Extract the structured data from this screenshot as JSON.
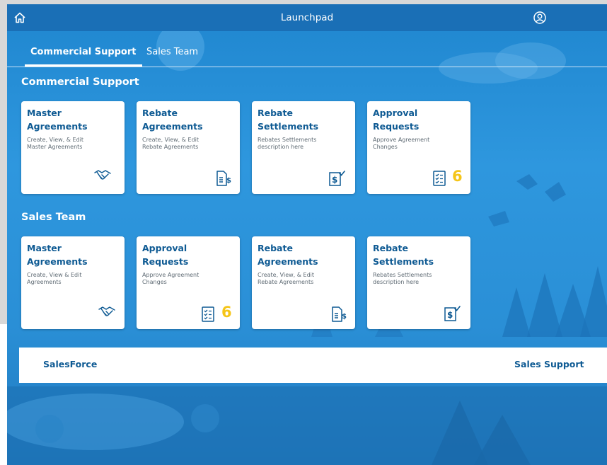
{
  "header": {
    "title": "Launchpad",
    "home_icon": "home-icon",
    "user_icon": "user-account-icon"
  },
  "tabs": [
    {
      "label": "Commercial Support",
      "active": true
    },
    {
      "label": "Sales Team",
      "active": false
    }
  ],
  "sections": [
    {
      "title": "Commercial Support",
      "tiles": [
        {
          "title_line1": "Master",
          "title_line2": "Agreements",
          "desc_line1": "Create, View, & Edit",
          "desc_line2": "Master Agreements",
          "icon": "handshake-icon",
          "badge": ""
        },
        {
          "title_line1": "Rebate",
          "title_line2": "Agreements",
          "desc_line1": "Create, View, & Edit",
          "desc_line2": "Rebate Agreements",
          "icon": "document-dollar-icon",
          "badge": ""
        },
        {
          "title_line1": "Rebate",
          "title_line2": "Settlements",
          "desc_line1": "Rebates Settlements",
          "desc_line2": "description here",
          "icon": "dollar-check-icon",
          "badge": ""
        },
        {
          "title_line1": "Approval",
          "title_line2": "Requests",
          "desc_line1": "Approve Agreement",
          "desc_line2": "Changes",
          "icon": "checklist-icon",
          "badge": "6"
        }
      ]
    },
    {
      "title": "Sales Team",
      "tiles": [
        {
          "title_line1": "Master",
          "title_line2": "Agreements",
          "desc_line1": "Create, View & Edit",
          "desc_line2": "Agreements",
          "icon": "handshake-icon",
          "badge": ""
        },
        {
          "title_line1": "Approval",
          "title_line2": "Requests",
          "desc_line1": "Approve Agreement",
          "desc_line2": "Changes",
          "icon": "checklist-icon",
          "badge": "6"
        },
        {
          "title_line1": "Rebate",
          "title_line2": "Agreements",
          "desc_line1": "Create, View, & Edit",
          "desc_line2": "Rebate Agreements",
          "icon": "document-dollar-icon",
          "badge": ""
        },
        {
          "title_line1": "Rebate",
          "title_line2": "Settlements",
          "desc_line1": "Rebates Settlements",
          "desc_line2": "description here",
          "icon": "dollar-check-icon",
          "badge": ""
        }
      ]
    }
  ],
  "footer": {
    "left_link": "SalesForce",
    "right_link": "Sales Support"
  },
  "colors": {
    "header_bg": "#1a6fb6",
    "page_bg": "#2e97de",
    "tile_title": "#0e5a93",
    "badge": "#f5c518"
  }
}
